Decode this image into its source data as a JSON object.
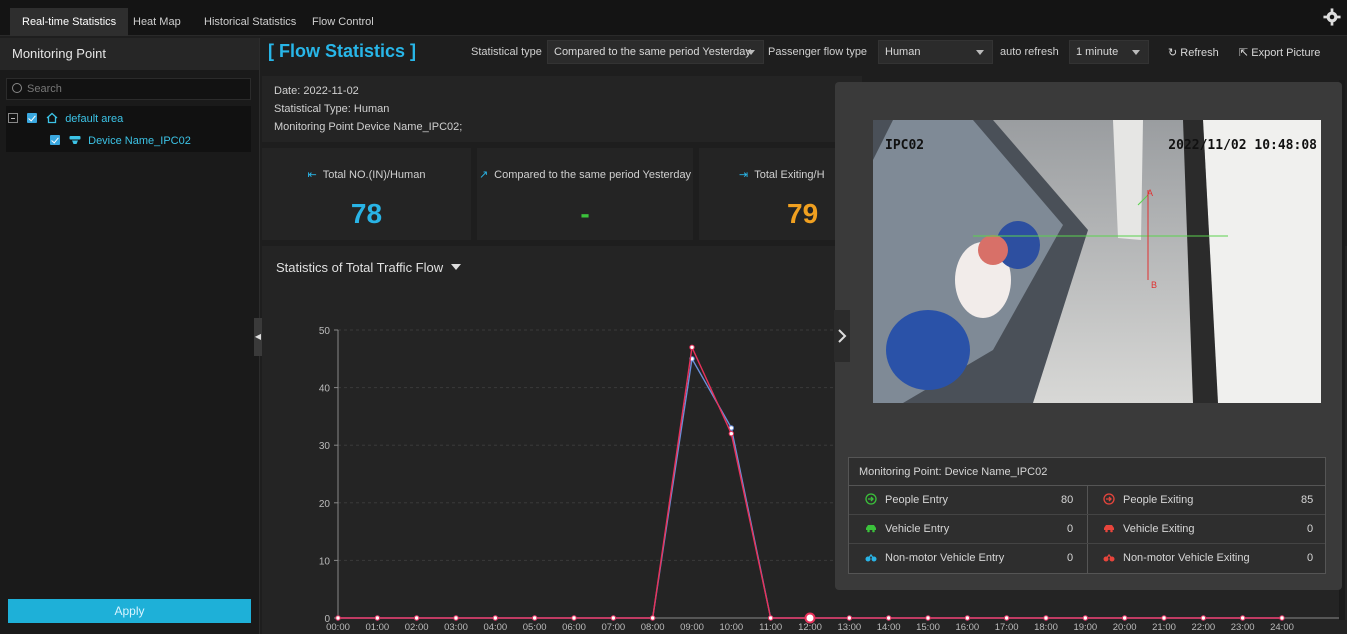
{
  "tabs": [
    {
      "label": "Real-time Statistics"
    },
    {
      "label": "Heat Map"
    },
    {
      "label": "Historical Statistics"
    },
    {
      "label": "Flow Control"
    }
  ],
  "sidebar": {
    "title": "Monitoring Point",
    "search_placeholder": "Search",
    "tree": {
      "area": "default area",
      "device": "Device Name_IPC02"
    },
    "apply_label": "Apply"
  },
  "header": {
    "title": "[ Flow Statistics ]",
    "statistical_type_label": "Statistical type",
    "statistical_type_value": "Compared to the same period Yesterday",
    "passenger_flow_label": "Passenger flow type",
    "passenger_flow_value": "Human",
    "auto_refresh_label": "auto refresh",
    "auto_refresh_value": "1 minute",
    "refresh_label": "Refresh",
    "export_label": "Export Picture"
  },
  "info": {
    "date": "Date: 2022-11-02",
    "type": "Statistical Type: Human",
    "point": "Monitoring Point Device Name_IPC02;"
  },
  "cards": [
    {
      "label": "Total NO.(IN)/Human",
      "value": "78",
      "color": "#29b4e6"
    },
    {
      "label": "Compared to the same period Yesterday",
      "value": "-",
      "color": "#3bc23b"
    },
    {
      "label": "Total Exiting/H",
      "value": "79",
      "color": "#f0a020"
    }
  ],
  "chart_title": "Statistics of Total Traffic Flow",
  "chart_data": {
    "type": "line",
    "x": [
      "00:00",
      "01:00",
      "02:00",
      "03:00",
      "04:00",
      "05:00",
      "06:00",
      "07:00",
      "08:00",
      "09:00",
      "10:00",
      "11:00",
      "12:00",
      "13:00",
      "14:00",
      "15:00",
      "16:00",
      "17:00",
      "18:00",
      "19:00",
      "20:00",
      "21:00",
      "22:00",
      "23:00",
      "24:00"
    ],
    "ylim": [
      0,
      50
    ],
    "yticks": [
      0,
      10,
      20,
      30,
      40,
      50
    ],
    "series": [
      {
        "values": [
          0,
          0,
          0,
          0,
          0,
          0,
          0,
          0,
          0,
          47,
          32,
          0,
          0,
          0,
          0,
          0,
          0,
          0,
          0,
          0,
          0,
          0,
          0,
          0,
          0
        ],
        "color": "#e8315a"
      },
      {
        "values": [
          0,
          0,
          0,
          0,
          0,
          0,
          0,
          0,
          0,
          45,
          33,
          0,
          0,
          0,
          0,
          0,
          0,
          0,
          0,
          0,
          0,
          0,
          0,
          0,
          0
        ],
        "color": "#6a8fd8"
      }
    ],
    "grid": true
  },
  "video": {
    "channel_text": "IPC02",
    "timestamp_text": "2022/11/02 10:48:08",
    "line_label_a": "A",
    "line_label_b": "B"
  },
  "monitor": {
    "title": "Monitoring Point: Device Name_IPC02",
    "rows": [
      {
        "left_label": "People Entry",
        "left_value": "80",
        "left_color": "#3bc23b",
        "left_icon": "enter-icon",
        "right_label": "People Exiting",
        "right_value": "85",
        "right_color": "#e8453c",
        "right_icon": "exit-icon"
      },
      {
        "left_label": "Vehicle Entry",
        "left_value": "0",
        "left_color": "#3bc23b",
        "left_icon": "car-icon",
        "right_label": "Vehicle Exiting",
        "right_value": "0",
        "right_color": "#e8453c",
        "right_icon": "car-icon"
      },
      {
        "left_label": "Non-motor Vehicle Entry",
        "left_value": "0",
        "left_color": "#29b4e6",
        "left_icon": "bike-icon",
        "right_label": "Non-motor Vehicle Exiting",
        "right_value": "0",
        "right_color": "#e8453c",
        "right_icon": "bike-icon"
      }
    ]
  }
}
